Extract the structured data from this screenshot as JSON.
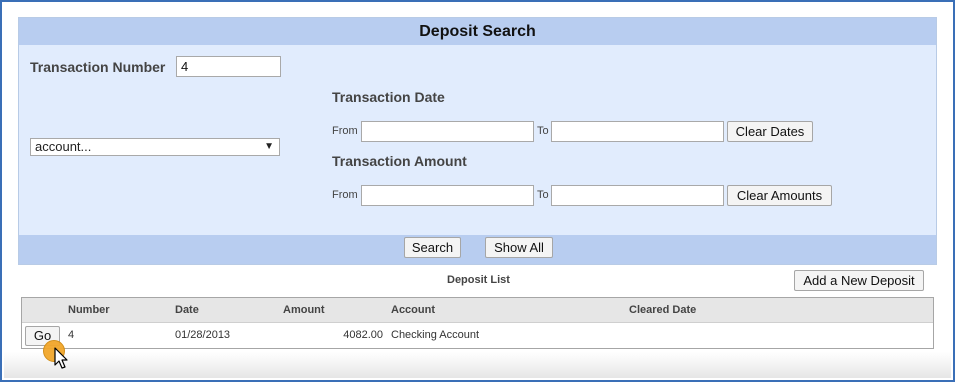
{
  "panel": {
    "title": "Deposit Search",
    "transaction_number_label": "Transaction Number",
    "transaction_number_value": "4",
    "account_select_value": "account...",
    "transaction_date_label": "Transaction Date",
    "transaction_amount_label": "Transaction Amount",
    "from_label": "From",
    "to_label": "To",
    "clear_dates_label": "Clear Dates",
    "clear_amounts_label": "Clear Amounts",
    "search_label": "Search",
    "show_all_label": "Show All"
  },
  "list": {
    "title": "Deposit List",
    "add_label": "Add a New Deposit",
    "columns": [
      "Number",
      "Date",
      "Amount",
      "Account",
      "Cleared Date"
    ],
    "rows": [
      {
        "go": "Go",
        "number": "4",
        "date": "01/28/2013",
        "amount": "4082.00",
        "account": "Checking Account",
        "cleared": ""
      }
    ]
  },
  "colors": {
    "header_bg": "#b8cdf0",
    "panel_bg": "#e1ecfd",
    "frame_border": "#3a6fb7",
    "cursor_highlight": "#f2a72b"
  }
}
